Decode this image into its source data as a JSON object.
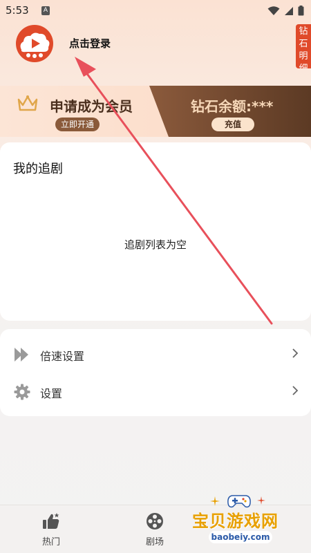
{
  "status_bar": {
    "time": "5:53",
    "notification_badge": "A"
  },
  "header": {
    "login_text": "点击登录",
    "diamond_detail_label": "钻石明细"
  },
  "member_banner": {
    "title": "申请成为会员",
    "activate_label": "立即开通",
    "diamond_balance": "钻石余额:***",
    "recharge_label": "充值"
  },
  "my_drama": {
    "title": "我的追剧",
    "empty_text": "追剧列表为空"
  },
  "settings": {
    "items": [
      {
        "label": "倍速设置",
        "icon": "fast-forward-icon"
      },
      {
        "label": "设置",
        "icon": "gear-icon"
      }
    ]
  },
  "bottom_nav": {
    "items": [
      {
        "label": "热门",
        "icon": "thumbs-up-icon"
      },
      {
        "label": "剧场",
        "icon": "film-reel-icon"
      }
    ]
  },
  "watermark": {
    "text": "宝贝游戏网",
    "url": "baobeiy.com"
  },
  "colors": {
    "accent_red": "#e04a2a",
    "banner_brown": "#8b5a3c",
    "banner_gold_text": "#f6d7b8",
    "arrow_red": "#e8505b"
  }
}
